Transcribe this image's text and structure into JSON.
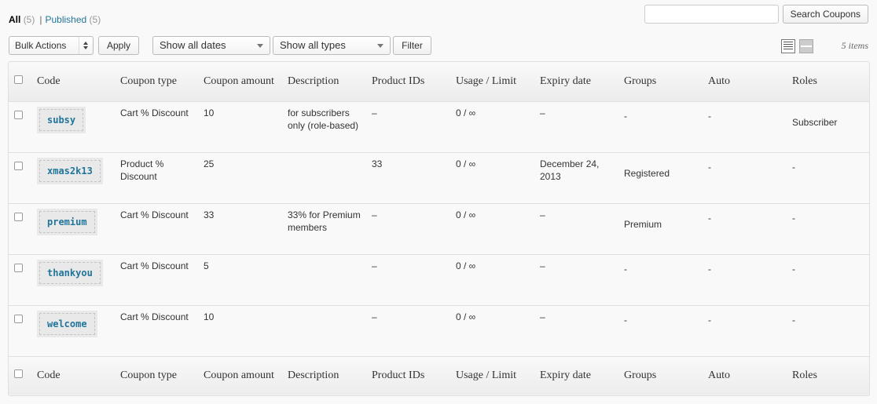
{
  "subsubsub": {
    "all_label": "All",
    "all_count": "(5)",
    "published_label": "Published",
    "published_count": "(5)",
    "separator": "|"
  },
  "search": {
    "value": "",
    "button_label": "Search Coupons"
  },
  "tablenav": {
    "bulk_actions": "Bulk Actions",
    "apply_label": "Apply",
    "dates_filter": "Show all dates",
    "types_filter": "Show all types",
    "filter_label": "Filter",
    "items_count": "5 items"
  },
  "columns": {
    "code": "Code",
    "coupon_type": "Coupon type",
    "coupon_amount": "Coupon amount",
    "description": "Description",
    "product_ids": "Product IDs",
    "usage_limit": "Usage / Limit",
    "expiry_date": "Expiry date",
    "groups": "Groups",
    "auto": "Auto",
    "roles": "Roles"
  },
  "rows": [
    {
      "code": "subsy",
      "type": "Cart % Discount",
      "amount": "10",
      "description": "for subscribers only (role-based)",
      "product_ids": "–",
      "usage": "0 / ∞",
      "expiry": "–",
      "groups": "-",
      "auto": "-",
      "roles": "Subscriber"
    },
    {
      "code": "xmas2k13",
      "type": "Product % Discount",
      "amount": "25",
      "description": "",
      "product_ids": "33",
      "usage": "0 / ∞",
      "expiry": "December 24, 2013",
      "groups": "Registered",
      "auto": "-",
      "roles": "-"
    },
    {
      "code": "premium",
      "type": "Cart % Discount",
      "amount": "33",
      "description": "33% for Premium members",
      "product_ids": "–",
      "usage": "0 / ∞",
      "expiry": "–",
      "groups": "Premium",
      "auto": "-",
      "roles": "-"
    },
    {
      "code": "thankyou",
      "type": "Cart % Discount",
      "amount": "5",
      "description": "",
      "product_ids": "–",
      "usage": "0 / ∞",
      "expiry": "–",
      "groups": "-",
      "auto": "-",
      "roles": "-"
    },
    {
      "code": "welcome",
      "type": "Cart % Discount",
      "amount": "10",
      "description": "",
      "product_ids": "–",
      "usage": "0 / ∞",
      "expiry": "–",
      "groups": "-",
      "auto": "-",
      "roles": "-"
    }
  ]
}
